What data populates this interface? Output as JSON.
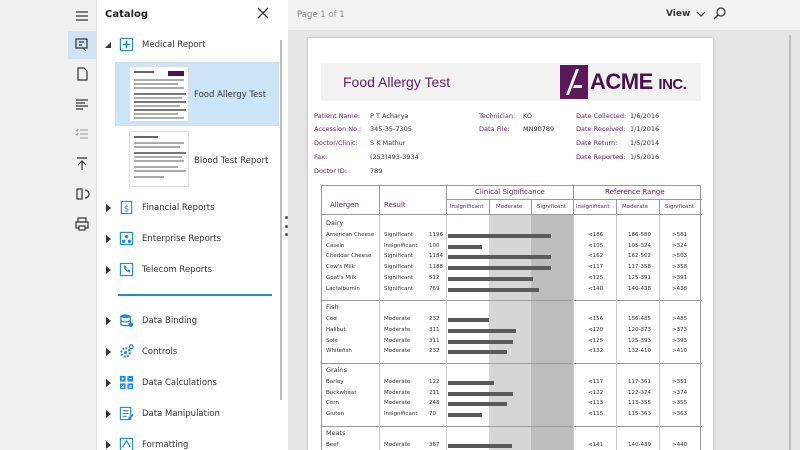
{
  "catalog": {
    "title": "Catalog",
    "groups": [
      {
        "label": "Medical Report",
        "icon": "medical-plus-icon",
        "expanded": true
      },
      {
        "label": "Financial Reports",
        "icon": "dollar-doc-icon"
      },
      {
        "label": "Enterprise Reports",
        "icon": "enterprise-icon"
      },
      {
        "label": "Telecom Reports",
        "icon": "phone-icon"
      },
      {
        "label": "Data Binding",
        "icon": "database-icon"
      },
      {
        "label": "Controls",
        "icon": "gear-icon"
      },
      {
        "label": "Data Calculations",
        "icon": "calculator-icon"
      },
      {
        "label": "Data Manipulation",
        "icon": "edit-doc-icon"
      },
      {
        "label": "Formatting",
        "icon": "format-icon"
      }
    ],
    "reports": [
      {
        "label": "Food Allergy Test",
        "selected": true
      },
      {
        "label": "Blood Test Report",
        "selected": false
      }
    ]
  },
  "viewer": {
    "page_info": "Page 1 of 1",
    "view_label": "View"
  },
  "document": {
    "title": "Food Allergy Test",
    "logo_main": "ACME",
    "logo_sub": "INC.",
    "info": [
      {
        "label": "Patient Name:",
        "value": "P T Acharya"
      },
      {
        "label": "Accession No.:",
        "value": "345-35-7305"
      },
      {
        "label": "Doctor/Clinic:",
        "value": "S K Mathur"
      },
      {
        "label": "Fax:",
        "value": "(253)493-3934"
      },
      {
        "label": "Doctor ID:",
        "value": "789"
      },
      {
        "label": "Technician:",
        "value": "KO"
      },
      {
        "label": "Data File:",
        "value": "MN90789"
      },
      {
        "label": "Date Collected:",
        "value": "1/6/2016"
      },
      {
        "label": "Date Received:",
        "value": "1/1/2016"
      },
      {
        "label": "Date Return:",
        "value": "1/5/2014"
      },
      {
        "label": "Date Reported:",
        "value": "1/5/2016"
      }
    ],
    "headers": {
      "allergen": "Allergen",
      "result": "Result",
      "clinical": "Clinical Significance",
      "reference": "Reference Range",
      "insignificant": "Insignificant",
      "moderate": "Moderate",
      "significant": "Significant"
    },
    "sections": [
      {
        "name": "Dairy",
        "rows": [
          {
            "allergen": "American Cheese",
            "result": "Significant",
            "value": "1196",
            "bar": 0.82,
            "ins": "<186",
            "mod": "186-580",
            "sig": ">581"
          },
          {
            "allergen": "Casein",
            "result": "Insignificant",
            "value": "100",
            "bar": 0.27,
            "ins": "<105",
            "mod": "105-324",
            "sig": ">324"
          },
          {
            "allergen": "Cheddar Cheese",
            "result": "Significant",
            "value": "1184",
            "bar": 0.82,
            "ins": "<162",
            "mod": "162-502",
            "sig": ">503"
          },
          {
            "allergen": "Cow's Milk",
            "result": "Significant",
            "value": "1188",
            "bar": 0.82,
            "ins": "<117",
            "mod": "117-358",
            "sig": ">358"
          },
          {
            "allergen": "Goat's Milk",
            "result": "Significant",
            "value": "512",
            "bar": 0.68,
            "ins": "<125",
            "mod": "125-391",
            "sig": ">391"
          },
          {
            "allergen": "Lactalbumin",
            "result": "Significant",
            "value": "769",
            "bar": 0.73,
            "ins": "<140",
            "mod": "140-438",
            "sig": ">438"
          }
        ]
      },
      {
        "name": "Fish",
        "rows": [
          {
            "allergen": "Cod",
            "result": "Moderate",
            "value": "232",
            "bar": 0.33,
            "ins": "<156",
            "mod": "156-485",
            "sig": ">485"
          },
          {
            "allergen": "Halibut",
            "result": "Moderate",
            "value": "311",
            "bar": 0.54,
            "ins": "<120",
            "mod": "120-373",
            "sig": ">373"
          },
          {
            "allergen": "Sole",
            "result": "Moderate",
            "value": "311",
            "bar": 0.52,
            "ins": "<125",
            "mod": "125-393",
            "sig": ">393"
          },
          {
            "allergen": "Whitefish",
            "result": "Moderate",
            "value": "232",
            "bar": 0.47,
            "ins": "<132",
            "mod": "132-410",
            "sig": ">410"
          }
        ]
      },
      {
        "name": "Grains",
        "rows": [
          {
            "allergen": "Barley",
            "result": "Moderate",
            "value": "122",
            "bar": 0.37,
            "ins": "<117",
            "mod": "117-361",
            "sig": ">351"
          },
          {
            "allergen": "Buckwheat",
            "result": "Moderate",
            "value": "211",
            "bar": 0.52,
            "ins": "<122",
            "mod": "122-374",
            "sig": ">374"
          },
          {
            "allergen": "Corn",
            "result": "Moderate",
            "value": "248",
            "bar": 0.47,
            "ins": "<113",
            "mod": "113-355",
            "sig": ">355"
          },
          {
            "allergen": "Gluten",
            "result": "Insignificant",
            "value": "70",
            "bar": 0.27,
            "ins": "<115",
            "mod": "115-363",
            "sig": ">363"
          }
        ]
      },
      {
        "name": "Meats",
        "rows": [
          {
            "allergen": "Beef",
            "result": "Moderate",
            "value": "367",
            "bar": 0.51,
            "ins": "<141",
            "mod": "140-439",
            "sig": ">440"
          }
        ]
      }
    ]
  }
}
